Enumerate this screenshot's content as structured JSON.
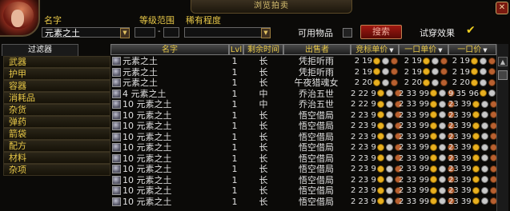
{
  "window": {
    "title": "浏览拍卖",
    "close_label": "✕"
  },
  "search": {
    "name_label": "名字",
    "name_value": "元素之土",
    "level_label": "等级范围",
    "level_dash": "-",
    "rarity_label": "稀有程度",
    "usable_label": "可用物品",
    "search_button": "搜索",
    "preview_label": "试穿效果"
  },
  "filter": {
    "tab_label": "过滤器",
    "categories": [
      "武器",
      "护甲",
      "容器",
      "消耗品",
      "杂货",
      "弹药",
      "箭袋",
      "配方",
      "材料",
      "杂项"
    ]
  },
  "columns": {
    "name": "名字",
    "lvl": "Lvl",
    "time": "剩余时间",
    "seller": "出售者",
    "bid": "竞标单价",
    "buyout_unit": "一口单价",
    "buyout": "一口价"
  },
  "rows": [
    {
      "name": "元素之土",
      "lvl": "1",
      "time": "长",
      "seller": "凭拒听雨",
      "bid": "2 19",
      "buy_unit": "2 19",
      "buyout": "2 19"
    },
    {
      "name": "元素之土",
      "lvl": "1",
      "time": "长",
      "seller": "凭拒听雨",
      "bid": "2 19",
      "buy_unit": "2 19",
      "buyout": "2 19"
    },
    {
      "name": "元素之土",
      "lvl": "1",
      "time": "长",
      "seller": "午夜猎魂女",
      "bid": "2 20",
      "buy_unit": "2 20",
      "buyout": "2 20"
    },
    {
      "name": "4 元素之土",
      "lvl": "1",
      "time": "中",
      "seller": "乔治五世",
      "bid": "2 22 9",
      "buy_unit": "2 33 99",
      "buyout": "9 35 96"
    },
    {
      "name": "10 元素之土",
      "lvl": "1",
      "time": "中",
      "seller": "乔治五世",
      "bid": "2 22 9",
      "buy_unit": "2 33 99",
      "buyout": "23 39"
    },
    {
      "name": "10 元素之土",
      "lvl": "1",
      "time": "长",
      "seller": "悟空借局",
      "bid": "2 23 9",
      "buy_unit": "2 33 99",
      "buyout": "23 39"
    },
    {
      "name": "10 元素之土",
      "lvl": "1",
      "time": "长",
      "seller": "悟空借局",
      "bid": "2 23 9",
      "buy_unit": "2 33 99",
      "buyout": "23 39"
    },
    {
      "name": "10 元素之土",
      "lvl": "1",
      "time": "长",
      "seller": "悟空借局",
      "bid": "2 23 9",
      "buy_unit": "2 33 99",
      "buyout": "23 39"
    },
    {
      "name": "10 元素之土",
      "lvl": "1",
      "time": "长",
      "seller": "悟空借局",
      "bid": "2 23 9",
      "buy_unit": "2 33 99",
      "buyout": "23 39"
    },
    {
      "name": "10 元素之土",
      "lvl": "1",
      "time": "长",
      "seller": "悟空借局",
      "bid": "2 23 9",
      "buy_unit": "2 33 99",
      "buyout": "23 39"
    },
    {
      "name": "10 元素之土",
      "lvl": "1",
      "time": "长",
      "seller": "悟空借局",
      "bid": "2 23 9",
      "buy_unit": "2 33 99",
      "buyout": "23 39"
    },
    {
      "name": "10 元素之土",
      "lvl": "1",
      "time": "长",
      "seller": "悟空借局",
      "bid": "2 23 9",
      "buy_unit": "2 33 99",
      "buyout": "23 39"
    },
    {
      "name": "10 元素之土",
      "lvl": "1",
      "time": "长",
      "seller": "悟空借局",
      "bid": "2 23 9",
      "buy_unit": "2 33 99",
      "buyout": "23 39"
    },
    {
      "name": "10 元素之土",
      "lvl": "1",
      "time": "长",
      "seller": "悟空借局",
      "bid": "2 23 9",
      "buy_unit": "2 33 99",
      "buyout": "23 39"
    }
  ],
  "colors": {
    "gold": "#e8b020",
    "silver": "#c8c8c8",
    "copper": "#b86030",
    "label": "#e8c848"
  },
  "icons": [
    "character-portrait-icon",
    "close-icon",
    "dropdown-arrow-icon",
    "checkbox-icon",
    "checkmark-icon",
    "item-icon",
    "scroll-up-icon",
    "sort-arrow-icon",
    "gold-coin-icon",
    "silver-coin-icon",
    "copper-coin-icon"
  ]
}
